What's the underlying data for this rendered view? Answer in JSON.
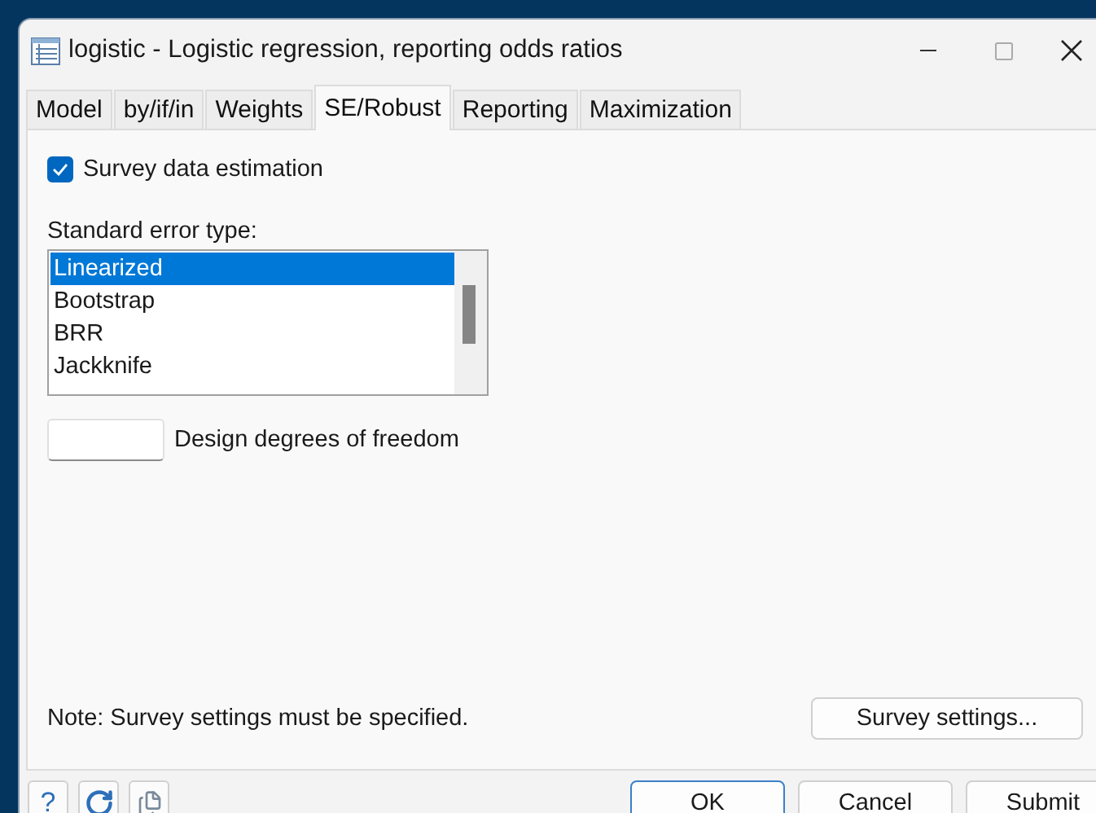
{
  "window": {
    "title": "logistic - Logistic regression, reporting odds ratios"
  },
  "tabs": [
    {
      "label": "Model",
      "selected": false
    },
    {
      "label": "by/if/in",
      "selected": false
    },
    {
      "label": "Weights",
      "selected": false
    },
    {
      "label": "SE/Robust",
      "selected": true
    },
    {
      "label": "Reporting",
      "selected": false
    },
    {
      "label": "Maximization",
      "selected": false
    }
  ],
  "survey_checkbox": {
    "label": "Survey data estimation",
    "checked": true
  },
  "se_type": {
    "label": "Standard error type:",
    "items": [
      {
        "label": "Linearized",
        "selected": true
      },
      {
        "label": "Bootstrap",
        "selected": false
      },
      {
        "label": "BRR",
        "selected": false
      },
      {
        "label": "Jackknife",
        "selected": false
      }
    ]
  },
  "design_df": {
    "label": "Design degrees of freedom"
  },
  "note": "Note: Survey settings must be specified.",
  "survey_settings_button": "Survey settings...",
  "help_button": "?",
  "buttons": [
    {
      "label": "OK",
      "default": true
    },
    {
      "label": "Cancel",
      "default": false
    },
    {
      "label": "Submit",
      "default": false
    }
  ]
}
